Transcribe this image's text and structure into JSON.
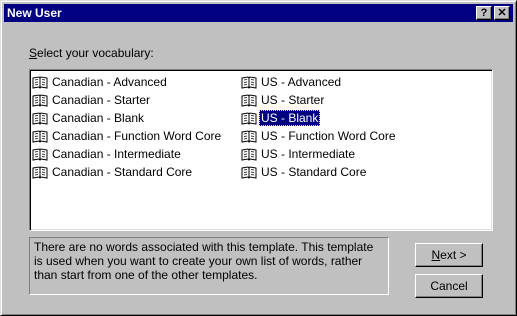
{
  "window": {
    "title": "New User",
    "help_button": "?",
    "close_button": "✕"
  },
  "prompt": {
    "mnemonic": "S",
    "rest": "elect your vocabulary:"
  },
  "vocabularies": [
    "Canadian - Advanced",
    "Canadian - Starter",
    "Canadian - Blank",
    "Canadian - Function Word Core",
    "Canadian - Intermediate",
    "Canadian - Standard Core",
    "US - Advanced",
    "US - Starter",
    "US - Blank",
    "US - Function Word Core",
    "US - Intermediate",
    "US - Standard Core"
  ],
  "selected_vocabulary": "US - Blank",
  "description": "There are no words associated with this template. This template is used when you want to create your own list of words, rather than start from one of the other templates.",
  "buttons": {
    "next_mnemonic": "N",
    "next_rest": "ext >",
    "cancel": "Cancel"
  },
  "icons": {
    "list_item_icon": "book-icon"
  },
  "colors": {
    "title_bar": "#000080",
    "selection": "#000080",
    "dialog_face": "#c0c0c0"
  }
}
